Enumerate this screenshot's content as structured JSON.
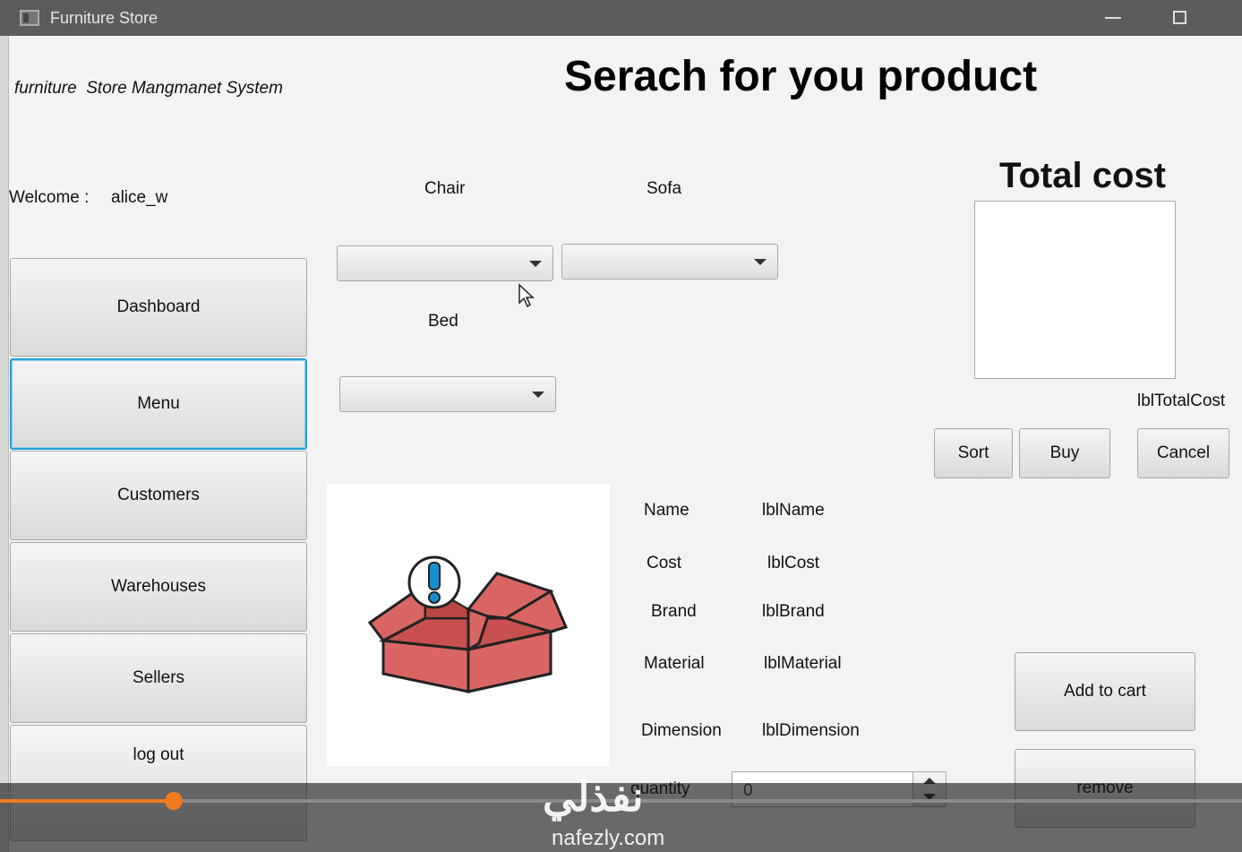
{
  "window": {
    "title": "Furniture Store"
  },
  "app": {
    "system_title": "furniture  Store Mangmanet System",
    "heading": "Serach for you product"
  },
  "welcome": {
    "label": "Welcome :",
    "user": "alice_w"
  },
  "nav": {
    "dashboard": "Dashboard",
    "menu": "Menu",
    "customers": "Customers",
    "warehouses": "Warehouses",
    "sellers": "Sellers",
    "logout": "log out"
  },
  "categories": {
    "chair": "Chair",
    "sofa": "Sofa",
    "bed": "Bed"
  },
  "total": {
    "title": "Total cost",
    "label": "lblTotalCost"
  },
  "actions": {
    "sort": "Sort",
    "buy": "Buy",
    "cancel": "Cancel",
    "add_to_cart": "Add to cart",
    "remove": "remove"
  },
  "details": {
    "name_label": "Name",
    "name_value": "lblName",
    "cost_label": "Cost",
    "cost_value": "lblCost",
    "brand_label": "Brand",
    "brand_value": "lblBrand",
    "material_label": "Material",
    "material_value": "lblMaterial",
    "dimension_label": "Dimension",
    "dimension_value": "lblDimension",
    "quantity_label": "quantity",
    "quantity_value": "0"
  },
  "video": {
    "progress": 0.14
  },
  "watermark": {
    "main": "نفذلي",
    "domain": "nafezly.com"
  },
  "colors": {
    "accent": "#2aa0d6",
    "progress": "#f07b1e",
    "box": "#d96565"
  }
}
